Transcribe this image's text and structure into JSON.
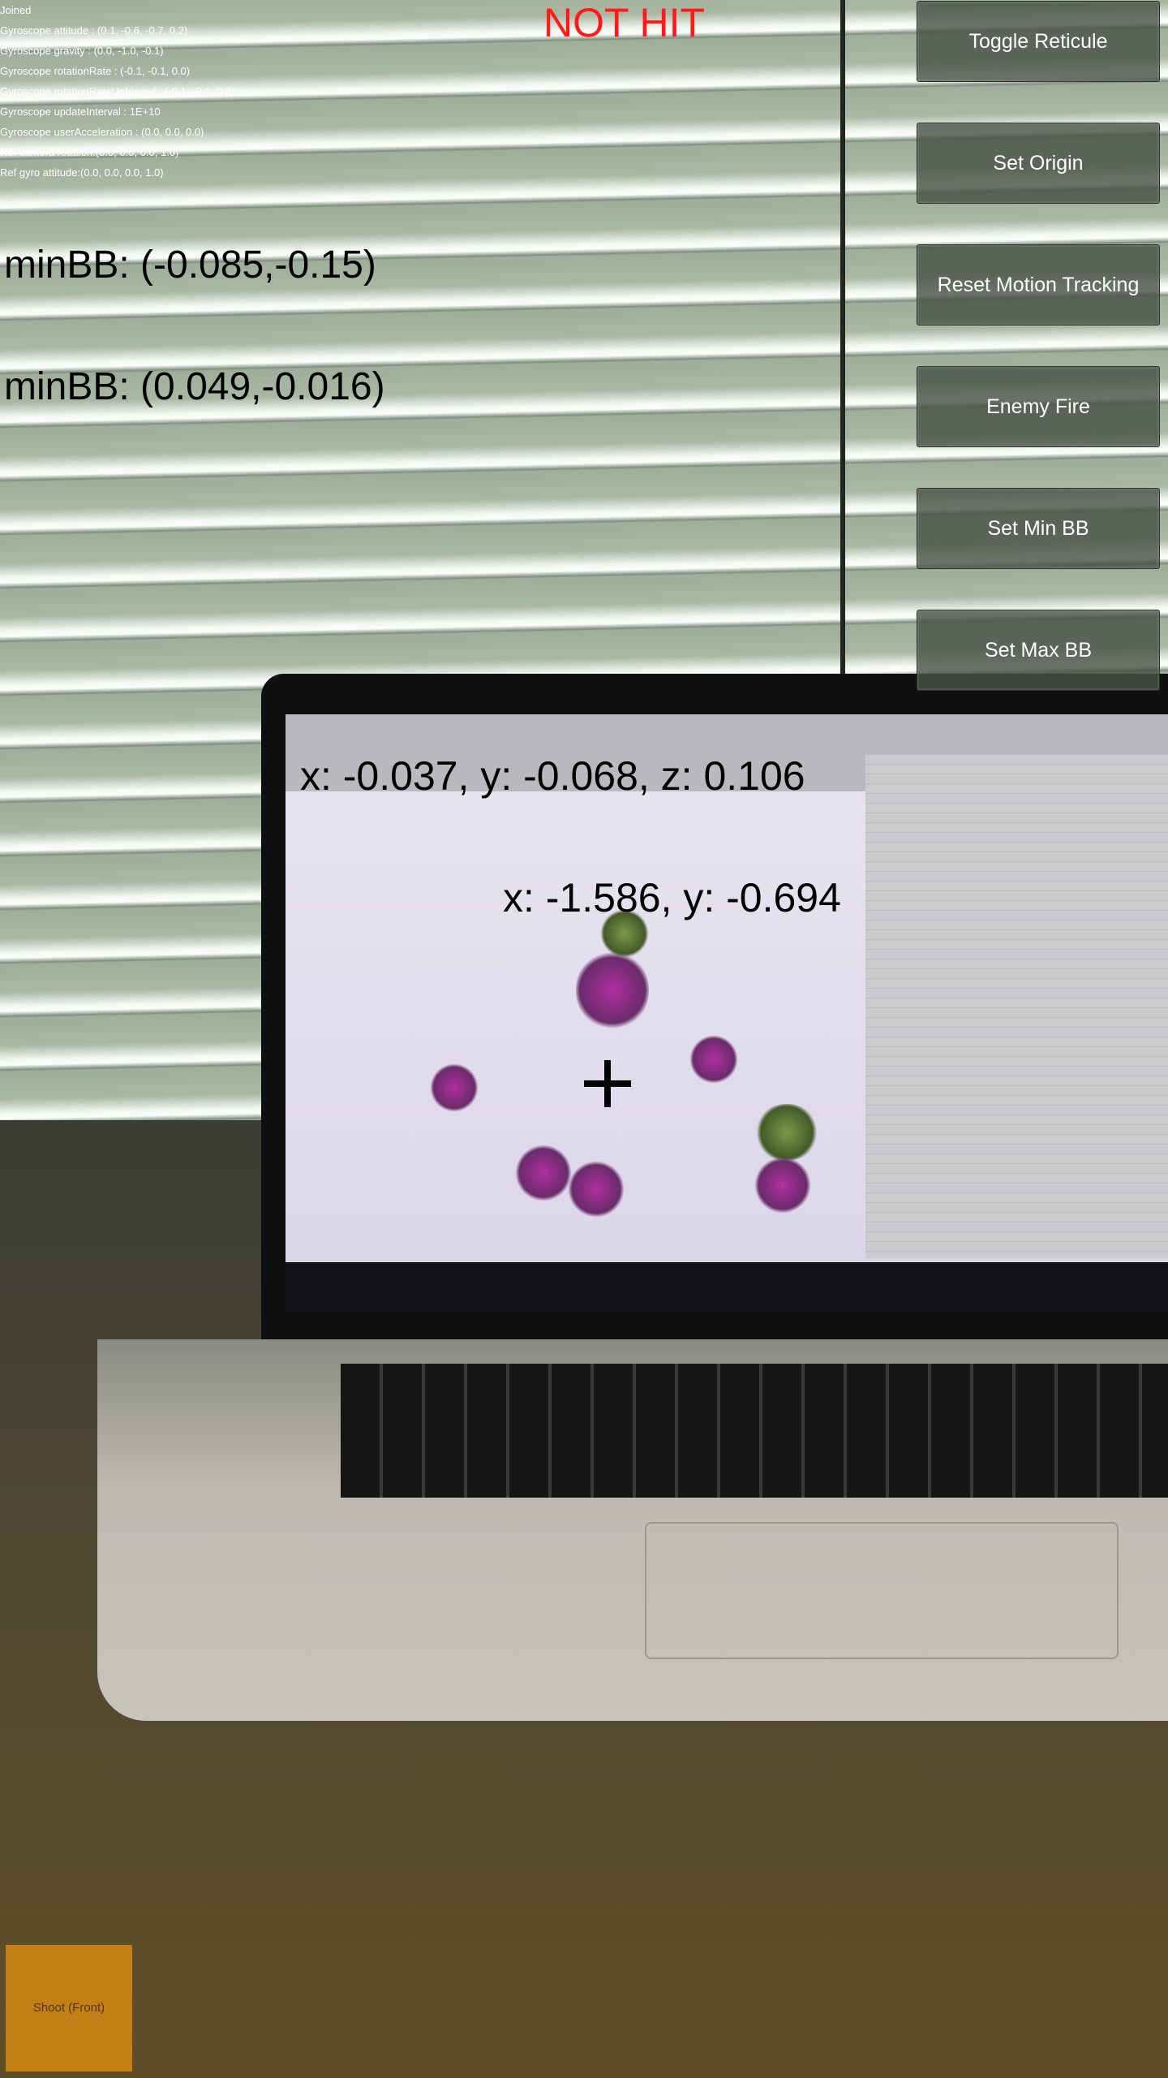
{
  "debug_lines": [
    "Joined",
    "Gyroscope attitude : (0.1, -0.6, -0.7, 0.2)",
    "Gyroscope gravity : (0.0, -1.0, -0.1)",
    "Gyroscope rotationRate : (-0.1, -0.1, 0.0)",
    "Gyroscope rotationRateUnbiased : (-0.1, -0.1, 0.0)",
    "Gyroscope updateInterval : 1E+10",
    "Gyroscope userAcceleration : (0.0, 0.0, 0.0)",
    "Ref camera rotation:(0.0, 0.0, 0.0, 1.0)",
    "Ref gyro attitude:(0.0, 0.0, 0.0, 1.0)"
  ],
  "hit_status": "NOT HIT",
  "bounding_boxes": {
    "first": "minBB: (-0.085,-0.15)",
    "second": "minBB: (0.049,-0.016)"
  },
  "world_position": "x: -0.037, y: -0.068, z: 0.106",
  "screen_position": "x: -1.586, y: -0.694",
  "buttons": {
    "toggle_reticule": "Toggle Reticule",
    "set_origin": "Set Origin",
    "reset_motion_tracking": "Reset Motion Tracking",
    "enemy_fire": "Enemy Fire",
    "set_min_bb": "Set Min BB",
    "set_max_bb": "Set Max BB",
    "shoot_front": "Shoot (Front)"
  },
  "colors": {
    "hit_status": "#ff1a1a",
    "button_bg": "#4b5248",
    "shoot_button_bg": "#c47f14"
  }
}
